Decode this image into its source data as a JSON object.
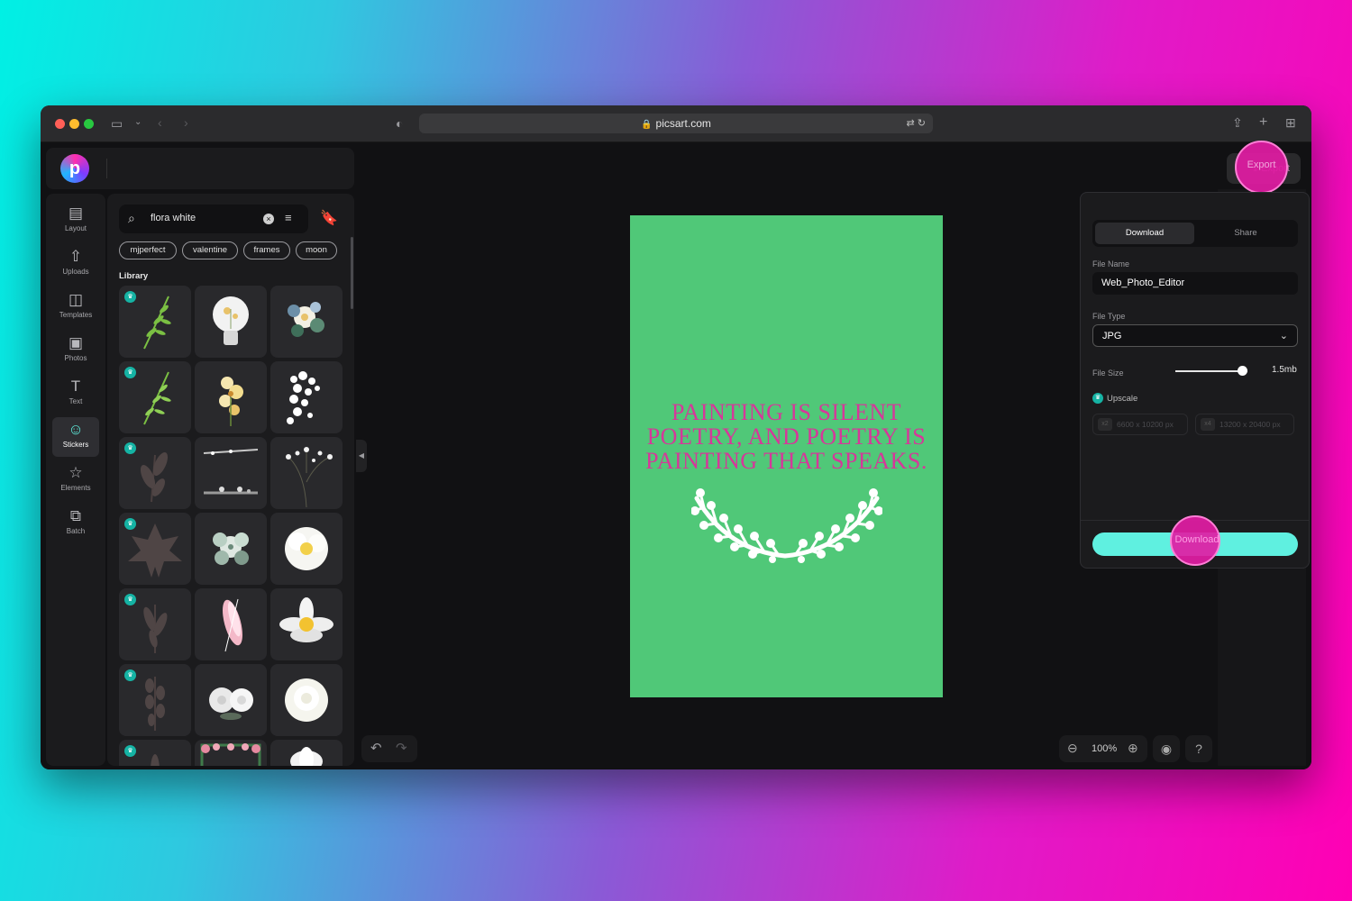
{
  "browser": {
    "url": "picsart.com",
    "icons": [
      "sidebar-icon",
      "back-icon",
      "forward-icon",
      "shield-icon",
      "lock-icon",
      "translate-icon",
      "reload-icon",
      "share-icon",
      "new-tab-icon",
      "tabs-overview-icon"
    ]
  },
  "sidebar": {
    "items": [
      {
        "label": "Layout",
        "icon": "layout-icon"
      },
      {
        "label": "Uploads",
        "icon": "upload-icon"
      },
      {
        "label": "Templates",
        "icon": "templates-icon"
      },
      {
        "label": "Photos",
        "icon": "photos-icon"
      },
      {
        "label": "Text",
        "icon": "text-icon"
      },
      {
        "label": "Stickers",
        "icon": "stickers-icon",
        "active": true
      },
      {
        "label": "Elements",
        "icon": "star-icon"
      },
      {
        "label": "Batch",
        "icon": "batch-icon"
      }
    ]
  },
  "panel": {
    "search_value": "flora white",
    "tags": [
      "mjperfect",
      "valentine",
      "frames",
      "moon"
    ],
    "library_title": "Library"
  },
  "canvas": {
    "quote": "PAINTING IS SILENT POETRY, AND POETRY IS PAINTING THAT SPEAKS.",
    "background": "#50c878",
    "text_color": "#d6379a"
  },
  "toolbar": {
    "zoom": "100%",
    "export_label": "Export"
  },
  "download_panel": {
    "tabs": [
      "Download",
      "Share"
    ],
    "file_name_label": "File Name",
    "file_name": "Web_Photo_Editor",
    "file_type_label": "File Type",
    "file_type": "JPG",
    "file_size_label": "File Size",
    "file_size": "1.5mb",
    "file_size_level": 0.93,
    "upscale_label": "Upscale",
    "upscale_options": [
      {
        "badge": "x2",
        "size": "6600 x 10200 px"
      },
      {
        "badge": "x4",
        "size": "13200 x 20400 px"
      }
    ],
    "download_label": "Download"
  },
  "colors": {
    "accent": "#5ff0e0",
    "highlight": "#e21ca4"
  }
}
